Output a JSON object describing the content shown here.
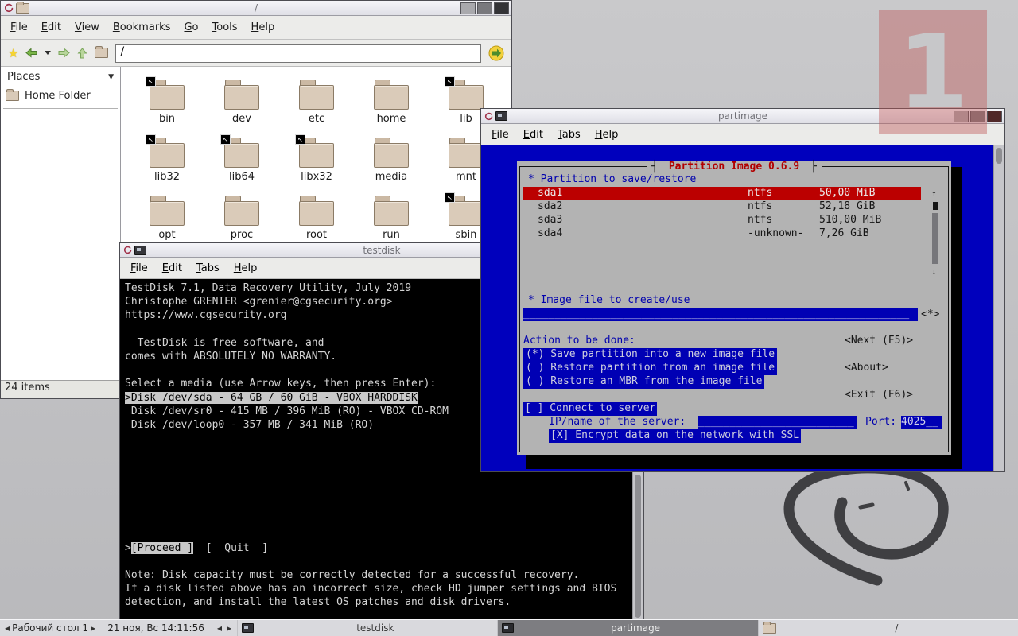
{
  "osd": {
    "workspace_number": "1"
  },
  "filemanager": {
    "window_title": "/",
    "menus": [
      "File",
      "Edit",
      "View",
      "Bookmarks",
      "Go",
      "Tools",
      "Help"
    ],
    "address_value": "/",
    "places_header": "Places",
    "places": [
      {
        "label": "Home Folder"
      }
    ],
    "folders": [
      {
        "name": "bin",
        "symlink": true
      },
      {
        "name": "dev",
        "symlink": false
      },
      {
        "name": "etc",
        "symlink": false
      },
      {
        "name": "home",
        "symlink": false
      },
      {
        "name": "lib",
        "symlink": true
      },
      {
        "name": "lib32",
        "symlink": true
      },
      {
        "name": "lib64",
        "symlink": true
      },
      {
        "name": "libx32",
        "symlink": true
      },
      {
        "name": "media",
        "symlink": false
      },
      {
        "name": "mnt",
        "symlink": false
      },
      {
        "name": "opt",
        "symlink": false
      },
      {
        "name": "proc",
        "symlink": false
      },
      {
        "name": "root",
        "symlink": false
      },
      {
        "name": "run",
        "symlink": false
      },
      {
        "name": "sbin",
        "symlink": true
      }
    ],
    "status": "24 items"
  },
  "testdisk": {
    "window_title": "testdisk",
    "menus": [
      "File",
      "Edit",
      "Tabs",
      "Help"
    ],
    "lines": [
      {
        "t": "TestDisk 7.1, Data Recovery Utility, July 2019"
      },
      {
        "t": "Christophe GRENIER <grenier@cgsecurity.org>"
      },
      {
        "t": "https://www.cgsecurity.org"
      },
      {
        "t": ""
      },
      {
        "t": "  TestDisk is free software, and"
      },
      {
        "t": "comes with ABSOLUTELY NO WARRANTY."
      },
      {
        "t": ""
      },
      {
        "t": "Select a media (use Arrow keys, then press Enter):"
      },
      {
        "sel": ">Disk /dev/sda - 64 GB / 60 GiB - VBOX HARDDISK"
      },
      {
        "t": " Disk /dev/sr0 - 415 MB / 396 MiB (RO) - VBOX CD-ROM"
      },
      {
        "t": " Disk /dev/loop0 - 357 MB / 341 MiB (RO)"
      },
      {
        "t": ""
      },
      {
        "t": ""
      },
      {
        "t": ""
      },
      {
        "t": ""
      },
      {
        "t": ""
      },
      {
        "t": ""
      },
      {
        "t": ""
      },
      {
        "t": ""
      },
      {
        "pre": ">",
        "sel": "[Proceed ]",
        "post": "  [  Quit  ]"
      },
      {
        "t": ""
      },
      {
        "t": "Note: Disk capacity must be correctly detected for a successful recovery."
      },
      {
        "t": "If a disk listed above has an incorrect size, check HD jumper settings and BIOS"
      },
      {
        "t": "detection, and install the latest OS patches and disk drivers."
      }
    ]
  },
  "partimage": {
    "window_title": "partimage",
    "menus": [
      "File",
      "Edit",
      "Tabs",
      "Help"
    ],
    "dialog_title": "Partition Image 0.6.9",
    "partition_section_label": "* Partition to save/restore",
    "partitions": [
      {
        "name": "sda1",
        "fs": "ntfs",
        "size": "50,00 MiB",
        "selected": true
      },
      {
        "name": "sda2",
        "fs": "ntfs",
        "size": "52,18 GiB",
        "selected": false
      },
      {
        "name": "sda3",
        "fs": "ntfs",
        "size": "510,00 MiB",
        "selected": false
      },
      {
        "name": "sda4",
        "fs": "-unknown-",
        "size": "7,26 GiB",
        "selected": false
      }
    ],
    "scroll_up": "↑",
    "scroll_down": "↓",
    "image_section_label": "* Image file to create/use",
    "image_file_value": "______________________________________________________________",
    "image_file_mark": "<*>",
    "action_label": "Action to be done:",
    "actions": [
      "(*) Save partition into a new image file",
      "( ) Restore partition from an image file",
      "( ) Restore an MBR from the image file"
    ],
    "buttons": {
      "next": "<Next (F5)>",
      "about": "<About>",
      "exit": "<Exit (F6)>"
    },
    "connect_label": "[ ] Connect to server",
    "ip_label": "IP/name of the server:",
    "ip_value": "_________________________",
    "port_label": "Port:",
    "port_value": "4025__",
    "ssl_label": "[X] Encrypt data on the network with SSL"
  },
  "taskbar": {
    "pager_label": "Рабочий стол 1",
    "clock": "21 ноя, Вс 14:11:56",
    "tasks": [
      {
        "label": "testdisk",
        "icon": "terminal",
        "active": false
      },
      {
        "label": "partimage",
        "icon": "terminal",
        "active": true
      },
      {
        "label": "/",
        "icon": "folder",
        "active": false
      }
    ]
  }
}
